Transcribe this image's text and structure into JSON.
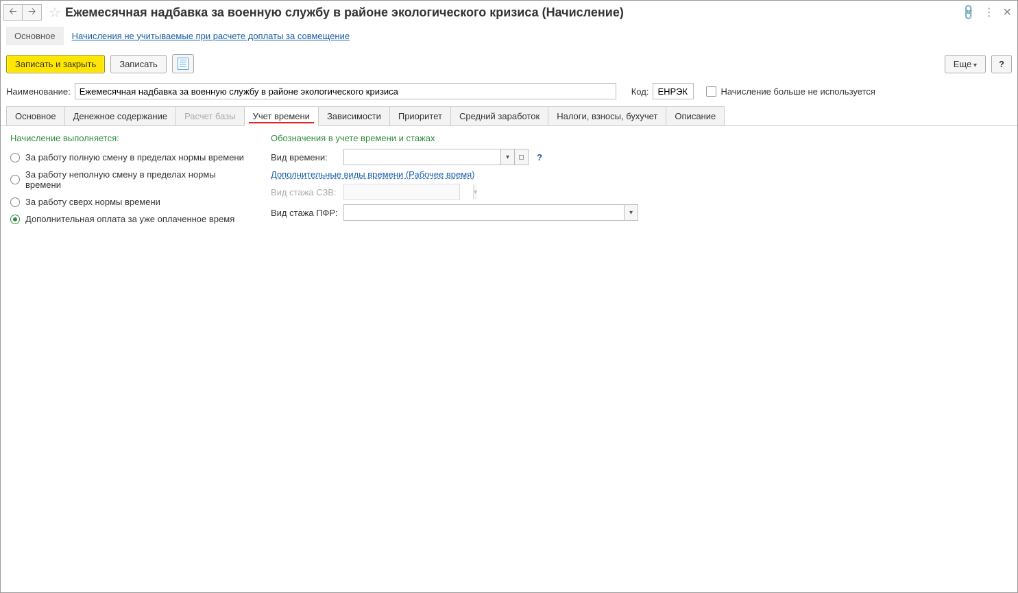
{
  "titlebar": {
    "title": "Ежемесячная надбавка за военную службу в районе экологического кризиса (Начисление)"
  },
  "subnav": {
    "main": "Основное",
    "link": "Начисления не учитываемые при расчете доплаты за совмещение"
  },
  "toolbar": {
    "save_close": "Записать и закрыть",
    "save": "Записать",
    "more": "Еще",
    "help": "?"
  },
  "form": {
    "name_label": "Наименование:",
    "name_value": "Ежемесячная надбавка за военную службу в районе экологического кризиса",
    "code_label": "Код:",
    "code_value": "ЕНРЭК",
    "not_used_label": "Начисление больше не используется"
  },
  "tabs": [
    {
      "label": "Основное"
    },
    {
      "label": "Денежное содержание"
    },
    {
      "label": "Расчет базы",
      "disabled": true
    },
    {
      "label": "Учет времени",
      "active": true
    },
    {
      "label": "Зависимости"
    },
    {
      "label": "Приоритет"
    },
    {
      "label": "Средний заработок"
    },
    {
      "label": "Налоги, взносы, бухучет"
    },
    {
      "label": "Описание"
    }
  ],
  "left": {
    "title": "Начисление выполняется:",
    "options": [
      "За работу полную смену в пределах нормы времени",
      "За работу неполную смену в пределах нормы времени",
      "За работу сверх нормы времени",
      "Дополнительная оплата за уже оплаченное время"
    ],
    "selected_index": 3
  },
  "right": {
    "title": "Обозначения в учете времени и стажах",
    "time_type_label": "Вид времени:",
    "extra_types_link": "Дополнительные виды времени (Рабочее время)",
    "szv_label": "Вид стажа СЗВ:",
    "pfr_label": "Вид стажа ПФР:"
  }
}
